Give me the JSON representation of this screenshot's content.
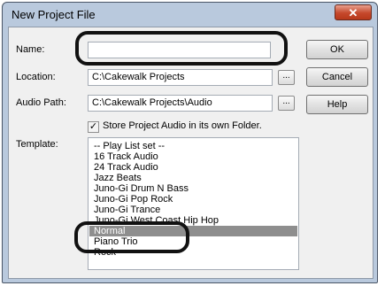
{
  "window": {
    "title": "New Project File",
    "close_glyph": "✕"
  },
  "fields": {
    "name_label": "Name:",
    "name_value": "",
    "location_label": "Location:",
    "location_value": "C:\\Cakewalk Projects",
    "audio_path_label": "Audio Path:",
    "audio_path_value": "C:\\Cakewalk Projects\\Audio",
    "browse_label": "...",
    "store_checkbox_checked": true,
    "store_checkbox_mark": "✓",
    "store_checkbox_label": "Store Project Audio in its own Folder.",
    "template_label": "Template:"
  },
  "buttons": {
    "ok": "OK",
    "cancel": "Cancel",
    "help": "Help"
  },
  "templates": [
    "-- Play List set --",
    "16 Track Audio",
    "24 Track Audio",
    "Jazz Beats",
    "Juno-Gi Drum N Bass",
    "Juno-Gi Pop Rock",
    "Juno-Gi Trance",
    "Juno-Gi West Coast Hip Hop",
    "Normal",
    "Piano Trio",
    "Rock"
  ],
  "selected_template": "Normal"
}
